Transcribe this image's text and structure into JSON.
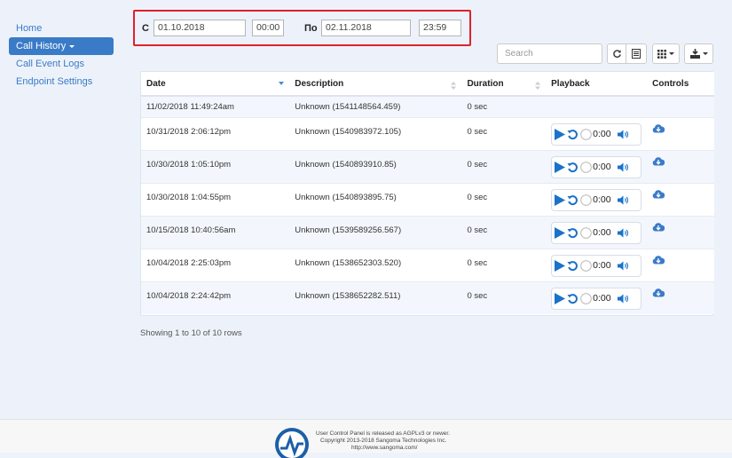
{
  "sidebar": {
    "items": [
      {
        "label": "Home"
      },
      {
        "label": "Call History"
      },
      {
        "label": "Call Event Logs"
      },
      {
        "label": "Endpoint Settings"
      }
    ]
  },
  "filter": {
    "from_label": "С",
    "from_date": "01.10.2018",
    "from_time": "00:00",
    "to_label": "По",
    "to_date": "02.11.2018",
    "to_time": "23:59"
  },
  "toolbar": {
    "search_placeholder": "Search",
    "icons": [
      "refresh-icon",
      "toggle-view-icon",
      "columns-icon",
      "export-icon"
    ]
  },
  "table": {
    "columns": [
      "Date",
      "Description",
      "Duration",
      "Playback",
      "Controls"
    ],
    "rows": [
      {
        "date": "11/02/2018 11:49:24am",
        "description": "Unknown (1541148564.459)",
        "duration": "0 sec",
        "has_playback": false
      },
      {
        "date": "10/31/2018 2:06:12pm",
        "description": "Unknown (1540983972.105)",
        "duration": "0 sec",
        "has_playback": true,
        "time": "0:00"
      },
      {
        "date": "10/30/2018 1:05:10pm",
        "description": "Unknown (1540893910.85)",
        "duration": "0 sec",
        "has_playback": true,
        "time": "0:00"
      },
      {
        "date": "10/30/2018 1:04:55pm",
        "description": "Unknown (1540893895.75)",
        "duration": "0 sec",
        "has_playback": true,
        "time": "0:00"
      },
      {
        "date": "10/15/2018 10:40:56am",
        "description": "Unknown (1539589256.567)",
        "duration": "0 sec",
        "has_playback": true,
        "time": "0:00"
      },
      {
        "date": "10/04/2018 2:25:03pm",
        "description": "Unknown (1538652303.520)",
        "duration": "0 sec",
        "has_playback": true,
        "time": "0:00"
      },
      {
        "date": "10/04/2018 2:24:42pm",
        "description": "Unknown (1538652282.511)",
        "duration": "0 sec",
        "has_playback": true,
        "time": "0:00"
      }
    ]
  },
  "pagination": {
    "summary": "Showing 1 to 10 of 10 rows"
  },
  "footer": {
    "line1": "User Control Panel is released as AGPLv3 or newer.",
    "line2": "Copyright 2013-2018 Sangoma Technologies Inc.",
    "line3": "http://www.sangoma.com/"
  },
  "colors": {
    "accent": "#3a7bc8",
    "filter_border": "#e0202b",
    "play": "#1a73c9"
  }
}
